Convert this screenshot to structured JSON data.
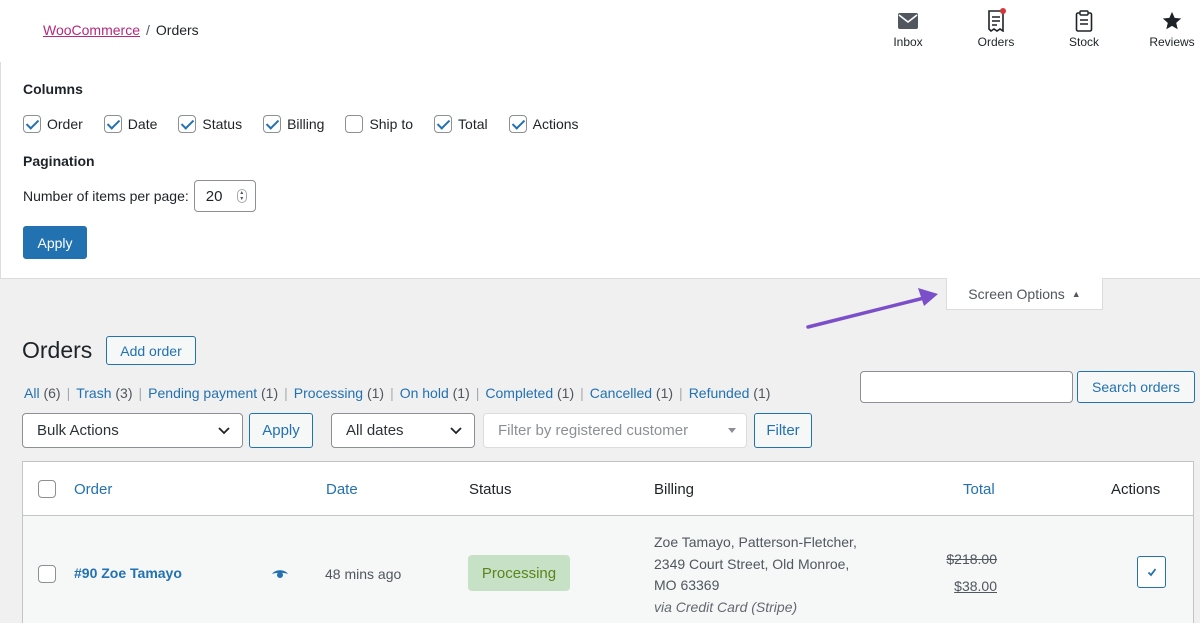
{
  "breadcrumb": {
    "parent": "WooCommerce",
    "separator": "/",
    "current": "Orders"
  },
  "activity": [
    {
      "label": "Inbox",
      "icon": "inbox-icon"
    },
    {
      "label": "Orders",
      "icon": "orders-icon"
    },
    {
      "label": "Stock",
      "icon": "stock-icon"
    },
    {
      "label": "Reviews",
      "icon": "star-icon"
    }
  ],
  "screen_options": {
    "columns_title": "Columns",
    "columns": [
      {
        "label": "Order",
        "checked": true
      },
      {
        "label": "Date",
        "checked": true
      },
      {
        "label": "Status",
        "checked": true
      },
      {
        "label": "Billing",
        "checked": true
      },
      {
        "label": "Ship to",
        "checked": false
      },
      {
        "label": "Total",
        "checked": true
      },
      {
        "label": "Actions",
        "checked": true
      }
    ],
    "pagination_title": "Pagination",
    "per_page_label": "Number of items per page:",
    "per_page_value": "20",
    "apply_label": "Apply",
    "tab_label": "Screen Options",
    "tab_caret": "▲"
  },
  "page": {
    "title": "Orders",
    "add_order_label": "Add order"
  },
  "views": [
    {
      "label": "All",
      "count": "(6)"
    },
    {
      "label": "Trash",
      "count": "(3)"
    },
    {
      "label": "Pending payment",
      "count": "(1)"
    },
    {
      "label": "Processing",
      "count": "(1)"
    },
    {
      "label": "On hold",
      "count": "(1)"
    },
    {
      "label": "Completed",
      "count": "(1)"
    },
    {
      "label": "Cancelled",
      "count": "(1)"
    },
    {
      "label": "Refunded",
      "count": "(1)"
    }
  ],
  "search": {
    "value": "",
    "button_label": "Search orders"
  },
  "filters": {
    "bulk_actions": "Bulk Actions",
    "apply_label": "Apply",
    "dates": "All dates",
    "customer_placeholder": "Filter by registered customer",
    "filter_label": "Filter"
  },
  "table": {
    "headers": {
      "order": "Order",
      "date": "Date",
      "status": "Status",
      "billing": "Billing",
      "total": "Total",
      "actions": "Actions"
    },
    "rows": [
      {
        "order": "#90 Zoe Tamayo",
        "date": "48 mins ago",
        "status": "Processing",
        "billing_lines": [
          "Zoe Tamayo, Patterson-Fletcher,",
          "2349 Court Street, Old Monroe,",
          "MO 63369"
        ],
        "billing_via": "via Credit Card (Stripe)",
        "total_old": "$218.00",
        "total_new": "$38.00"
      }
    ]
  },
  "colors": {
    "accent": "#2271b1",
    "breadcrumb_link": "#b5297e",
    "status_processing_bg": "#c6e1c6",
    "status_processing_text": "#5b841b",
    "annotation_arrow": "#7b4fc9"
  }
}
